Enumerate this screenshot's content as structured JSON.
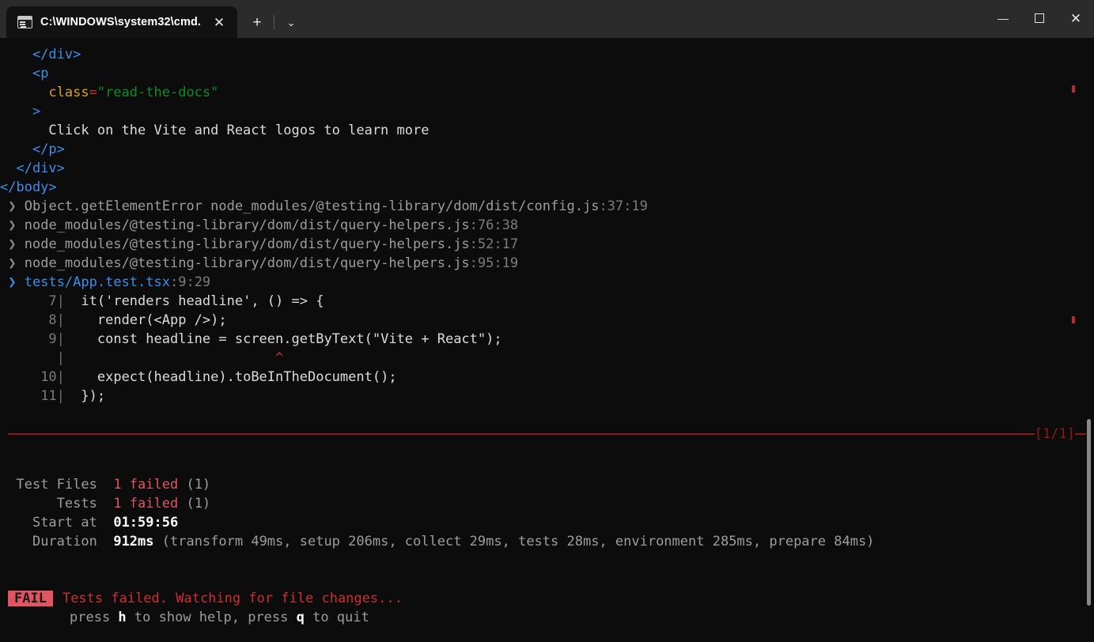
{
  "window": {
    "tab": {
      "title": "C:\\WINDOWS\\system32\\cmd.",
      "icon": "cmd-terminal-icon",
      "close_label": "✕"
    },
    "newtab_label": "+",
    "dropdown_label": "⌄",
    "controls": {
      "minimize": "—",
      "maximize": "",
      "close": "✕"
    }
  },
  "colors": {
    "background": "#0c0c0c",
    "titlebar": "#2b2b2b",
    "tab_active": "#121212",
    "tag_blue": "#3b8eea",
    "attr_yellow": "#d7a227",
    "string_green": "#0f8c22",
    "fail_red": "#e05561",
    "rule_dark_red": "#8b1a1a",
    "dim_gray": "#9d9d9d"
  },
  "terminal": {
    "markup_lines": [
      {
        "indent": "    ",
        "parts": [
          {
            "text": "</div>",
            "cls": "c-tag"
          }
        ]
      },
      {
        "indent": "    ",
        "parts": [
          {
            "text": "<p",
            "cls": "c-tag"
          }
        ]
      },
      {
        "indent": "      ",
        "parts": [
          {
            "text": "class",
            "cls": "c-attr"
          },
          {
            "text": "=",
            "cls": "c-eq"
          },
          {
            "text": "\"read-the-docs\"",
            "cls": "c-str"
          }
        ]
      },
      {
        "indent": "    ",
        "parts": [
          {
            "text": ">",
            "cls": "c-tag"
          }
        ]
      },
      {
        "indent": "      ",
        "parts": [
          {
            "text": "Click on the Vite and React logos to learn more",
            "cls": "c-text"
          }
        ]
      },
      {
        "indent": "    ",
        "parts": [
          {
            "text": "</p>",
            "cls": "c-tag"
          }
        ]
      },
      {
        "indent": "  ",
        "parts": [
          {
            "text": "</div>",
            "cls": "c-tag"
          }
        ]
      },
      {
        "indent": "",
        "parts": [
          {
            "text": "</body>",
            "cls": "c-tag"
          }
        ]
      }
    ],
    "stack_frames": [
      {
        "chevron": "❯",
        "chevron_cls": "c-dim2",
        "text": "Object.getElementError node_modules/@testing-library/dom/dist/config.js",
        "text_cls": "c-dim",
        "loc": ":37:19",
        "loc_cls": "c-num"
      },
      {
        "chevron": "❯",
        "chevron_cls": "c-dim2",
        "text": "node_modules/@testing-library/dom/dist/query-helpers.js",
        "text_cls": "c-dim",
        "loc": ":76:38",
        "loc_cls": "c-num"
      },
      {
        "chevron": "❯",
        "chevron_cls": "c-dim2",
        "text": "node_modules/@testing-library/dom/dist/query-helpers.js",
        "text_cls": "c-dim",
        "loc": ":52:17",
        "loc_cls": "c-num"
      },
      {
        "chevron": "❯",
        "chevron_cls": "c-dim2",
        "text": "node_modules/@testing-library/dom/dist/query-helpers.js",
        "text_cls": "c-dim",
        "loc": ":95:19",
        "loc_cls": "c-num"
      },
      {
        "chevron": "❯",
        "chevron_cls": "c-blue",
        "text": "tests/App.test.tsx",
        "text_cls": "c-blue",
        "loc": ":9:29",
        "loc_cls": "c-num"
      }
    ],
    "code_frame": [
      {
        "lineno": " 7",
        "code": "  it('renders headline', () => {"
      },
      {
        "lineno": " 8",
        "code": "    render(<App />);"
      },
      {
        "lineno": " 9",
        "code": "    const headline = screen.getByText(\"Vite + React\");"
      },
      {
        "lineno": "  ",
        "code": "",
        "caret": true,
        "caret_col": 26,
        "caret_char": "^"
      },
      {
        "lineno": "10",
        "code": "    expect(headline).toBeInTheDocument();"
      },
      {
        "lineno": "11",
        "code": "  });"
      }
    ],
    "separator": {
      "counter": "[1/1]"
    },
    "summary": [
      {
        "label": "Test Files",
        "value": "1 failed",
        "value_cls": "c-red",
        "suffix": " (1)",
        "suffix_cls": "c-dim"
      },
      {
        "label": "Tests",
        "value": "1 failed",
        "value_cls": "c-red",
        "suffix": " (1)",
        "suffix_cls": "c-dim"
      },
      {
        "label": "Start at",
        "value": "01:59:56",
        "value_cls": "c-bright",
        "suffix": "",
        "suffix_cls": "c-dim"
      },
      {
        "label": "Duration",
        "value": "912ms",
        "value_cls": "c-bright",
        "suffix": " (transform 49ms, setup 206ms, collect 29ms, tests 28ms, environment 285ms, prepare 84ms)",
        "suffix_cls": "c-dim"
      }
    ],
    "footer": {
      "badge": "FAIL",
      "message": "Tests failed. Watching for file changes...",
      "help_pre": "press ",
      "help_key1": "h",
      "help_mid": " to show help, press ",
      "help_key2": "q",
      "help_post": " to quit"
    }
  }
}
